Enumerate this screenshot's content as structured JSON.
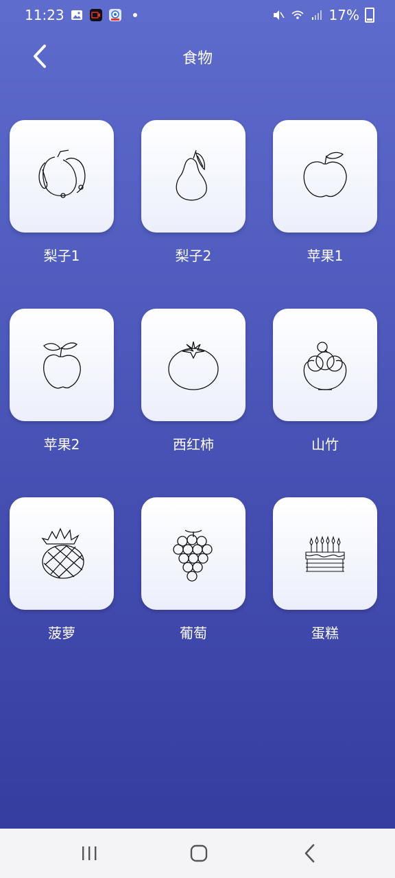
{
  "status": {
    "time": "11:23",
    "battery": "17%"
  },
  "header": {
    "title": "食物"
  },
  "items": [
    {
      "label": "梨子1",
      "icon": "pears-drawing-icon"
    },
    {
      "label": "梨子2",
      "icon": "pear-drawing-icon"
    },
    {
      "label": "苹果1",
      "icon": "apple-drawing-icon"
    },
    {
      "label": "苹果2",
      "icon": "apple-drawing-icon"
    },
    {
      "label": "西红柿",
      "icon": "tomato-drawing-icon"
    },
    {
      "label": "山竹",
      "icon": "mangosteen-drawing-icon"
    },
    {
      "label": "菠萝",
      "icon": "pineapple-drawing-icon"
    },
    {
      "label": "葡萄",
      "icon": "grapes-drawing-icon"
    },
    {
      "label": "蛋糕",
      "icon": "cake-drawing-icon"
    }
  ],
  "colors": {
    "bg_top": "#5e6ccd",
    "bg_bottom": "#333a9c",
    "card": "#ffffff",
    "nav_bar": "#f4f4f6"
  }
}
